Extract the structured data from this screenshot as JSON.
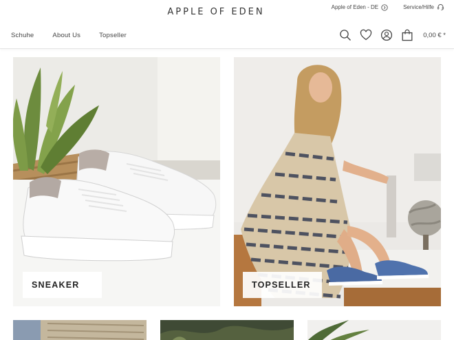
{
  "brand": {
    "logo": "APPLE OF EDEN"
  },
  "topbar": {
    "region": "Apple of Eden - DE",
    "region_icon": "chevron-circle-icon",
    "service": "Service/Hilfe",
    "service_icon": "headset-icon"
  },
  "nav": {
    "items": [
      {
        "label": "Schuhe"
      },
      {
        "label": "About Us"
      },
      {
        "label": "Topseller"
      }
    ]
  },
  "actions": {
    "icons": [
      "search-icon",
      "heart-icon",
      "user-icon",
      "shopping-bag-icon"
    ],
    "cart_total": "0,00 € *"
  },
  "tiles": [
    {
      "label": "SNEAKER",
      "image": "white-sneakers-with-plant"
    },
    {
      "label": "TOPSELLER",
      "image": "woman-in-dress-with-blue-shoes"
    }
  ],
  "colors": {
    "text": "#3c3c3c",
    "header_border": "#e6e6e6",
    "label_bg": "#ffffff"
  }
}
